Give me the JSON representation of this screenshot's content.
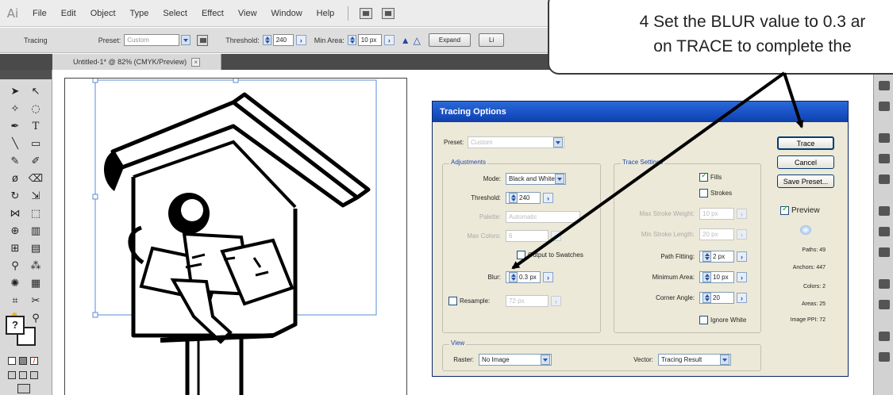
{
  "menubar": {
    "logo": "Ai",
    "items": [
      "File",
      "Edit",
      "Object",
      "Type",
      "Select",
      "Effect",
      "View",
      "Window",
      "Help"
    ]
  },
  "control_bar": {
    "mode_label": "Tracing",
    "preset_label": "Preset:",
    "preset_value": "Custom",
    "threshold_label": "Threshold:",
    "threshold_value": "240",
    "min_area_label": "Min Area:",
    "min_area_value": "10 px",
    "expand_label": "Expand",
    "live_label": "Li"
  },
  "document_tab": {
    "title": "Untitled-1* @ 82% (CMYK/Preview)",
    "close_label": "×"
  },
  "dialog": {
    "title": "Tracing Options",
    "preset_label": "Preset:",
    "preset_value": "Custom",
    "adjustments": {
      "legend": "Adjustments",
      "mode_label": "Mode:",
      "mode_value": "Black and White",
      "threshold_label": "Threshold:",
      "threshold_value": "240",
      "palette_label": "Palette:",
      "palette_value": "Automatic",
      "max_colors_label": "Max Colors:",
      "max_colors_value": "6",
      "output_swatches_label": "Output to Swatches",
      "blur_label": "Blur:",
      "blur_value": "0.3 px",
      "resample_label": "Resample:",
      "resample_value": "72 px"
    },
    "trace_settings": {
      "legend": "Trace Settings",
      "fills_label": "Fills",
      "strokes_label": "Strokes",
      "max_stroke_weight_label": "Max Stroke Weight:",
      "max_stroke_weight_value": "10 px",
      "min_stroke_length_label": "Min Stroke Length:",
      "min_stroke_length_value": "20 px",
      "path_fitting_label": "Path Fitting:",
      "path_fitting_value": "2 px",
      "minimum_area_label": "Minimum Area:",
      "minimum_area_value": "10 px",
      "corner_angle_label": "Corner Angle:",
      "corner_angle_value": "20",
      "ignore_white_label": "Ignore White"
    },
    "view": {
      "legend": "View",
      "raster_label": "Raster:",
      "raster_value": "No Image",
      "vector_label": "Vector:",
      "vector_value": "Tracing Result"
    },
    "buttons": {
      "trace": "Trace",
      "cancel": "Cancel",
      "save_preset": "Save Preset..."
    },
    "preview_label": "Preview",
    "stats": {
      "paths": "Paths: 49",
      "anchors": "Anchors: 447",
      "colors": "Colors: 2",
      "areas": "Areas: 25",
      "image_ppi": "Image PPI: 72"
    }
  },
  "callout": {
    "line1": "4  Set the BLUR value to 0.3 ar",
    "line2": "on TRACE to complete the"
  }
}
